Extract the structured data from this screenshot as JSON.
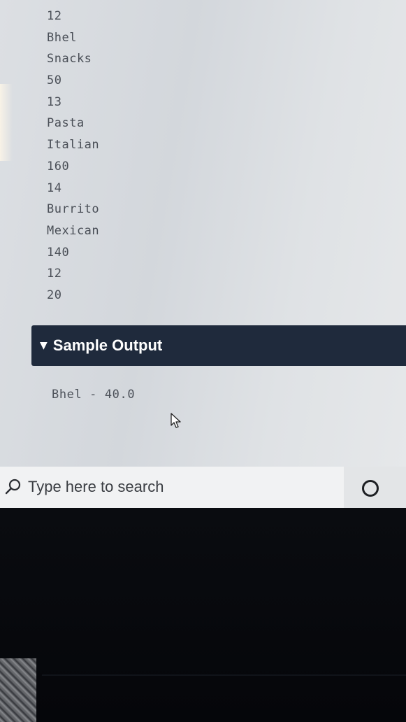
{
  "sample_input": {
    "lines": [
      "12",
      "Bhel",
      "Snacks",
      "50",
      "13",
      "Pasta",
      "Italian",
      "160",
      "14",
      "Burrito",
      "Mexican",
      "140",
      "12",
      "20"
    ]
  },
  "sample_output": {
    "header": "Sample Output",
    "text": "Bhel - 40.0"
  },
  "taskbar": {
    "search_placeholder": "Type here to search"
  },
  "icons": [
    "triangle-down-icon",
    "mouse-cursor-icon",
    "search-icon",
    "cortana-icon"
  ]
}
